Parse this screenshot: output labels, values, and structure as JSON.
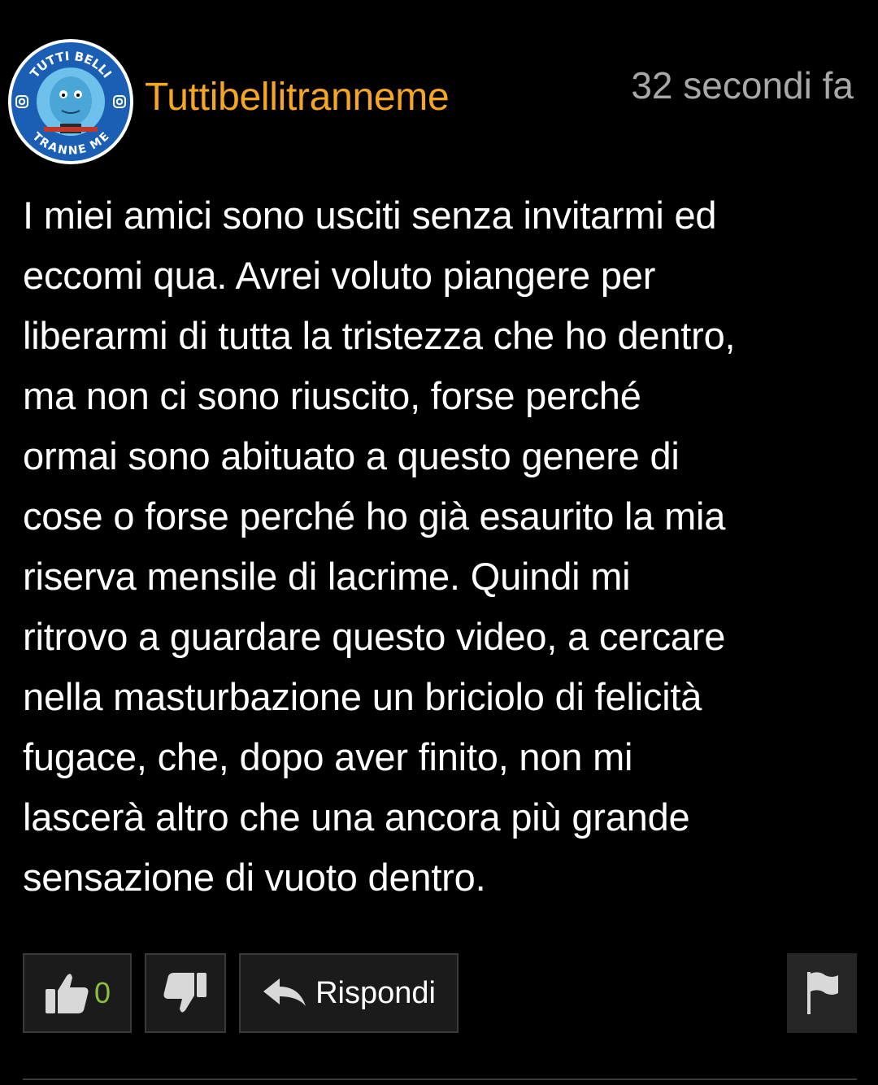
{
  "comment": {
    "avatar": {
      "ring_top_text": "TUTTI BELLI",
      "ring_bottom_text": "TRANNE ME",
      "icon": "instagram-icon"
    },
    "username": "Tuttibellitranneme",
    "timestamp": "32 secondi fa",
    "text": "I miei amici sono usciti senza invitarmi ed\neccomi qua. Avrei voluto piangere per\nliberarmi di tutta la tristezza che ho dentro,\nma non ci sono riuscito, forse perché\normai sono abituato a questo genere di\ncose o forse perché ho già esaurito la mia\nriserva mensile di lacrime. Quindi mi\nritrovo a guardare questo video, a cercare\nnella masturbazione un briciolo di felicità\nfugace, che, dopo aver finito, non mi\nlascerà altro che una ancora più grande\nsensazione di vuoto dentro.",
    "actions": {
      "like_count": "0",
      "reply_label": "Rispondi"
    }
  },
  "colors": {
    "background": "#000000",
    "username": "#f5a623",
    "timestamp": "#a8a8a8",
    "like_count": "#8bbf3c",
    "button_bg": "#1b1b1b",
    "button_border": "#3a3a3a"
  }
}
